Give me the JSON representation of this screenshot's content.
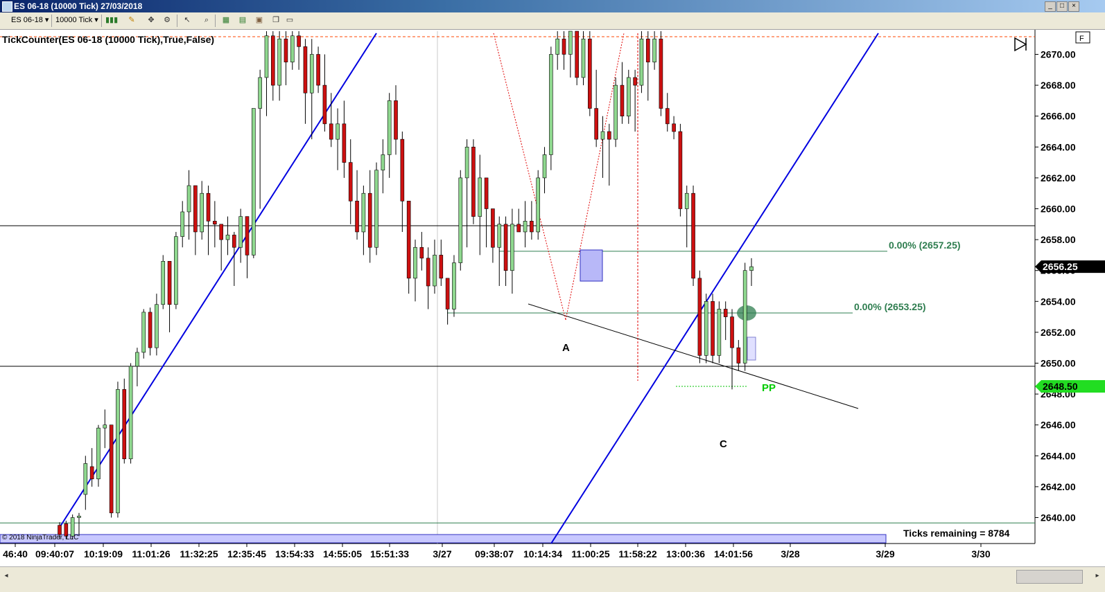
{
  "window": {
    "title": "ES 06-18 (10000 Tick)  27/03/2018",
    "controls": [
      "_",
      "□",
      "×"
    ]
  },
  "toolbar": {
    "instrument": "ES 06-18",
    "period": "10000 Tick"
  },
  "chart_header": {
    "indicator_label": "TickCounter(ES 06-18 (10000 Tick),True,False)",
    "copyright": "© 2018 NinjaTrader, LLC",
    "ticks_remaining": "Ticks remaining = 8784"
  },
  "chart_data": {
    "type": "candlestick",
    "instrument": "ES 06-18 (10000 Tick)",
    "ylim": [
      2638.75,
      2671.75
    ],
    "y_ticks": [
      "2670.00",
      "2668.00",
      "2666.00",
      "2664.00",
      "2662.00",
      "2660.00",
      "2658.00",
      "2656.00",
      "2654.00",
      "2652.00",
      "2650.00",
      "2648.00",
      "2646.00",
      "2644.00",
      "2642.00",
      "2640.00"
    ],
    "x_ticks": [
      "46:40",
      "09:40:07",
      "10:19:09",
      "11:01:26",
      "11:32:25",
      "12:35:45",
      "13:54:33",
      "14:55:05",
      "15:51:33",
      "3/27",
      "09:38:07",
      "10:14:34",
      "11:00:25",
      "11:58:22",
      "13:00:36",
      "14:01:56",
      "3/28",
      "3/29",
      "3/30"
    ],
    "last_price": "2656.25",
    "pivot_price": "2648.50",
    "horizontal_lines": [
      2658.9,
      2649.8,
      2639.65
    ],
    "fib_levels": [
      {
        "label": "0.00% (2657.25)",
        "price": 2657.25
      },
      {
        "label": "0.00% (2653.25)",
        "price": 2653.25
      }
    ],
    "annotations": [
      "A",
      "C",
      "PP"
    ],
    "candles": [
      [
        2639.5,
        2639.7,
        2638.6,
        2638.9
      ],
      [
        2639.6,
        2639.8,
        2638.6,
        2638.8
      ],
      [
        2638.8,
        2640.2,
        2638.6,
        2640.0
      ],
      [
        2640.0,
        2640.3,
        2638.8,
        2640.1
      ],
      [
        2641.5,
        2644.0,
        2640.5,
        2643.5
      ],
      [
        2643.3,
        2644.5,
        2642.0,
        2642.5
      ],
      [
        2642.5,
        2646.0,
        2642.0,
        2645.8
      ],
      [
        2645.8,
        2647.0,
        2644.5,
        2646.0
      ],
      [
        2646.0,
        2643.0,
        2640.0,
        2640.3
      ],
      [
        2640.3,
        2648.8,
        2640.0,
        2648.3
      ],
      [
        2648.3,
        2649.0,
        2643.5,
        2643.8
      ],
      [
        2643.8,
        2650.0,
        2643.5,
        2649.8
      ],
      [
        2649.8,
        2651.0,
        2648.5,
        2650.7
      ],
      [
        2650.7,
        2653.5,
        2650.3,
        2653.3
      ],
      [
        2653.3,
        2653.6,
        2650.5,
        2651.0
      ],
      [
        2651.0,
        2654.5,
        2650.5,
        2653.8
      ],
      [
        2653.8,
        2657.0,
        2653.5,
        2656.6
      ],
      [
        2656.6,
        2656.6,
        2652.0,
        2653.8
      ],
      [
        2653.8,
        2658.5,
        2653.5,
        2658.2
      ],
      [
        2658.2,
        2660.5,
        2657.5,
        2659.8
      ],
      [
        2659.8,
        2662.5,
        2658.0,
        2661.5
      ],
      [
        2661.5,
        2661.5,
        2657.0,
        2658.5
      ],
      [
        2658.5,
        2661.8,
        2658.0,
        2661.0
      ],
      [
        2661.0,
        2661.5,
        2657.0,
        2659.2
      ],
      [
        2659.2,
        2660.5,
        2657.5,
        2659.0
      ],
      [
        2659.0,
        2659.0,
        2656.0,
        2658.0
      ],
      [
        2658.0,
        2659.5,
        2657.0,
        2658.3
      ],
      [
        2658.3,
        2658.5,
        2655.0,
        2657.5
      ],
      [
        2657.5,
        2660.0,
        2656.5,
        2659.5
      ],
      [
        2659.5,
        2659.5,
        2655.5,
        2657.0
      ],
      [
        2657.0,
        2664.0,
        2656.8,
        2666.5
      ],
      [
        2666.5,
        2669.0,
        2660.0,
        2668.5
      ],
      [
        2668.5,
        2671.5,
        2666.0,
        2671.2
      ],
      [
        2671.2,
        2671.5,
        2667.0,
        2668.0
      ],
      [
        2668.0,
        2671.5,
        2667.0,
        2671.0
      ],
      [
        2671.0,
        2671.5,
        2668.0,
        2669.5
      ],
      [
        2669.5,
        2671.5,
        2669.0,
        2671.2
      ],
      [
        2671.2,
        2671.5,
        2669.0,
        2670.5
      ],
      [
        2670.5,
        2671.0,
        2665.5,
        2667.5
      ],
      [
        2667.5,
        2671.0,
        2664.5,
        2670.0
      ],
      [
        2670.0,
        2670.5,
        2667.5,
        2668.0
      ],
      [
        2668.0,
        2670.0,
        2665.0,
        2665.5
      ],
      [
        2665.5,
        2667.5,
        2664.0,
        2664.5
      ],
      [
        2664.5,
        2666.5,
        2662.5,
        2665.5
      ],
      [
        2665.5,
        2667.0,
        2662.0,
        2663.0
      ],
      [
        2663.0,
        2664.5,
        2659.0,
        2660.5
      ],
      [
        2660.5,
        2662.5,
        2658.0,
        2658.5
      ],
      [
        2658.5,
        2661.5,
        2657.0,
        2661.0
      ],
      [
        2661.0,
        2662.5,
        2656.5,
        2657.5
      ],
      [
        2657.5,
        2663.0,
        2657.0,
        2662.5
      ],
      [
        2662.5,
        2664.5,
        2661.0,
        2663.5
      ],
      [
        2663.5,
        2667.5,
        2662.0,
        2667.0
      ],
      [
        2667.0,
        2668.0,
        2663.5,
        2664.5
      ],
      [
        2664.5,
        2665.0,
        2658.5,
        2660.5
      ],
      [
        2660.5,
        2660.5,
        2654.5,
        2655.5
      ],
      [
        2655.5,
        2658.0,
        2654.0,
        2657.5
      ],
      [
        2657.5,
        2658.5,
        2656.0,
        2656.8
      ],
      [
        2656.8,
        2657.5,
        2653.5,
        2655.0
      ],
      [
        2655.0,
        2658.0,
        2654.5,
        2657.0
      ],
      [
        2657.0,
        2658.0,
        2655.0,
        2655.5
      ],
      [
        2655.5,
        2655.5,
        2652.5,
        2653.5
      ],
      [
        2653.5,
        2657.0,
        2653.0,
        2656.5
      ],
      [
        2656.5,
        2662.5,
        2656.0,
        2662.0
      ],
      [
        2662.0,
        2664.5,
        2657.5,
        2664.0
      ],
      [
        2664.0,
        2664.5,
        2659.0,
        2659.5
      ],
      [
        2659.5,
        2663.5,
        2657.0,
        2662.0
      ],
      [
        2662.0,
        2662.0,
        2657.5,
        2660.0
      ],
      [
        2660.0,
        2660.0,
        2656.5,
        2657.5
      ],
      [
        2657.5,
        2659.5,
        2655.0,
        2659.0
      ],
      [
        2659.0,
        2659.5,
        2655.0,
        2656.0
      ],
      [
        2656.0,
        2660.0,
        2654.5,
        2659.0
      ],
      [
        2659.0,
        2660.0,
        2658.5,
        2658.5
      ],
      [
        2658.5,
        2660.5,
        2657.5,
        2659.2
      ],
      [
        2659.2,
        2660.5,
        2658.0,
        2658.5
      ],
      [
        2658.5,
        2662.5,
        2658.0,
        2662.0
      ],
      [
        2662.0,
        2664.0,
        2661.0,
        2663.5
      ],
      [
        2663.5,
        2670.5,
        2662.5,
        2670.0
      ],
      [
        2670.0,
        2671.5,
        2669.0,
        2671.0
      ],
      [
        2671.0,
        2671.5,
        2669.0,
        2670.0
      ],
      [
        2670.0,
        2671.5,
        2668.5,
        2671.5
      ],
      [
        2671.5,
        2671.5,
        2668.0,
        2668.5
      ],
      [
        2668.5,
        2671.5,
        2668.0,
        2671.0
      ],
      [
        2671.0,
        2671.5,
        2666.0,
        2666.5
      ],
      [
        2666.5,
        2669.0,
        2664.0,
        2664.5
      ],
      [
        2664.5,
        2666.0,
        2662.0,
        2665.0
      ],
      [
        2665.0,
        2665.5,
        2661.5,
        2664.5
      ],
      [
        2664.5,
        2668.5,
        2664.0,
        2668.0
      ],
      [
        2668.0,
        2669.5,
        2665.5,
        2666.0
      ],
      [
        2666.0,
        2669.0,
        2665.5,
        2668.5
      ],
      [
        2668.5,
        2669.0,
        2665.0,
        2668.0
      ],
      [
        2668.0,
        2671.5,
        2667.5,
        2671.0
      ],
      [
        2671.0,
        2671.5,
        2667.0,
        2669.5
      ],
      [
        2669.5,
        2671.5,
        2669.0,
        2671.0
      ],
      [
        2671.0,
        2671.5,
        2666.0,
        2666.5
      ],
      [
        2666.5,
        2667.5,
        2665.0,
        2665.5
      ],
      [
        2665.5,
        2666.0,
        2664.5,
        2665.0
      ],
      [
        2665.0,
        2665.5,
        2659.5,
        2660.0
      ],
      [
        2660.0,
        2661.5,
        2657.5,
        2661.0
      ],
      [
        2661.0,
        2661.5,
        2655.0,
        2655.5
      ],
      [
        2655.5,
        2656.0,
        2650.0,
        2650.5
      ],
      [
        2650.5,
        2654.5,
        2650.0,
        2654.0
      ],
      [
        2654.0,
        2654.5,
        2650.0,
        2650.5
      ],
      [
        2650.5,
        2654.0,
        2650.0,
        2653.5
      ],
      [
        2653.5,
        2654.0,
        2651.5,
        2653.0
      ],
      [
        2653.0,
        2653.5,
        2648.3,
        2651.0
      ],
      [
        2651.0,
        2651.5,
        2649.5,
        2650.0
      ],
      [
        2650.0,
        2656.5,
        2649.5,
        2656.0
      ],
      [
        2656.0,
        2656.8,
        2655.0,
        2656.25
      ]
    ]
  }
}
